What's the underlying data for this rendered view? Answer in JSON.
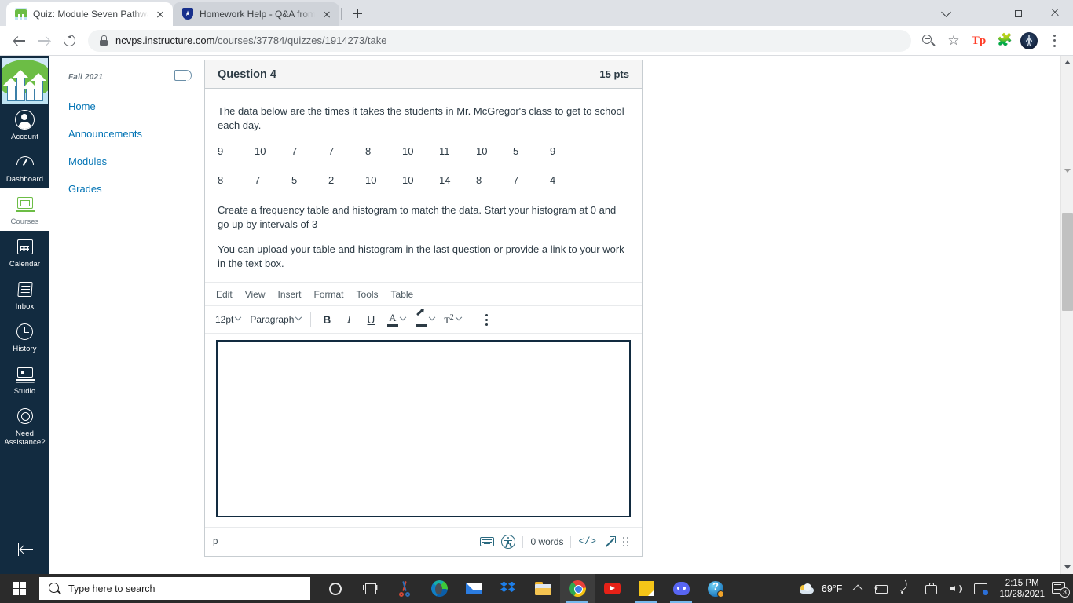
{
  "browser": {
    "tabs": [
      {
        "title": "Quiz: Module Seven Pathway Two",
        "favicon": "ncvps-logo-icon",
        "active": true
      },
      {
        "title": "Homework Help - Q&A from Onli",
        "favicon": "coursehero-shield-icon",
        "active": false
      }
    ],
    "new_tab_label": "+",
    "url_secure": "ncvps.instructure.com",
    "url_path": "/courses/37784/quizzes/1914273/take",
    "toolbar_icons": [
      "zoom-out-icon",
      "bookmark-star-icon",
      "tpt-extension-icon",
      "extensions-puzzle-icon",
      "profile-avatar-icon",
      "chrome-menu-icon"
    ],
    "window_controls": [
      "tab-search-chevron-icon",
      "minimize-icon",
      "maximize-icon",
      "close-icon"
    ]
  },
  "global_nav": {
    "logo_name": "ncvps-logo",
    "items": [
      {
        "label": "Account",
        "icon": "account-icon",
        "active": false
      },
      {
        "label": "Dashboard",
        "icon": "dashboard-icon",
        "active": false
      },
      {
        "label": "Courses",
        "icon": "courses-icon",
        "active": true
      },
      {
        "label": "Calendar",
        "icon": "calendar-icon",
        "active": false
      },
      {
        "label": "Inbox",
        "icon": "inbox-icon",
        "active": false
      },
      {
        "label": "History",
        "icon": "history-icon",
        "active": false
      },
      {
        "label": "Studio",
        "icon": "studio-icon",
        "active": false
      },
      {
        "label": "Need Assistance?",
        "icon": "help-icon",
        "active": false
      }
    ],
    "collapse_label": "minimize-nav-icon"
  },
  "course_nav": {
    "term": "Fall 2021",
    "links": [
      "Home",
      "Announcements",
      "Modules",
      "Grades"
    ],
    "pin_icon": "collapse-course-nav-icon"
  },
  "question": {
    "title": "Question 4",
    "points": "15 pts",
    "prompt": "The data below are the times it takes the students in Mr. McGregor's class to get to school each day.",
    "data_rows": [
      [
        "9",
        "10",
        "7",
        "7",
        "8",
        "10",
        "11",
        "10",
        "5",
        "9"
      ],
      [
        "8",
        "7",
        "5",
        "2",
        "10",
        "10",
        "14",
        "8",
        "7",
        "4"
      ]
    ],
    "instruction_1": "Create a frequency table and histogram to match the data. Start your histogram at 0 and go up by intervals of 3",
    "instruction_2": "You can upload your table and histogram in the last question or provide a link to your work in the text box."
  },
  "editor": {
    "menus": [
      "Edit",
      "View",
      "Insert",
      "Format",
      "Tools",
      "Table"
    ],
    "font_size": "12pt",
    "block_format": "Paragraph",
    "buttons": [
      {
        "label": "B",
        "name": "bold-button"
      },
      {
        "label": "I",
        "name": "italic-button"
      },
      {
        "label": "U",
        "name": "underline-button"
      }
    ],
    "text_color_label": "A",
    "superscript_label": "T",
    "superscript_exp": "2",
    "more_label": "more-options-icon",
    "body_value": "",
    "status": {
      "element_path": "p",
      "word_count": "0 words",
      "code_label": "</>",
      "icons": [
        "keyboard-shortcuts-icon",
        "accessibility-checker-icon",
        "html-editor-icon",
        "fullscreen-icon",
        "resize-handle-icon"
      ]
    }
  },
  "taskbar": {
    "start_label": "start-button",
    "search_placeholder": "Type here to search",
    "apps": [
      {
        "name": "cortana-icon"
      },
      {
        "name": "task-view-icon"
      },
      {
        "name": "snipping-tool-icon"
      },
      {
        "name": "microsoft-edge-icon"
      },
      {
        "name": "mail-icon"
      },
      {
        "name": "dropbox-icon"
      },
      {
        "name": "file-explorer-icon"
      },
      {
        "name": "google-chrome-icon"
      },
      {
        "name": "youtube-icon"
      },
      {
        "name": "sticky-notes-icon"
      },
      {
        "name": "discord-icon"
      },
      {
        "name": "help-icon"
      }
    ],
    "weather_temp": "69°F",
    "tray_icons": [
      "show-hidden-icons-chevron",
      "battery-icon",
      "wifi-icon",
      "camera-icon",
      "volume-icon",
      "display-icon"
    ],
    "time": "2:15 PM",
    "date": "10/28/2021",
    "notification_count": "3"
  },
  "colors": {
    "canvas_nav_bg": "#122b40",
    "link_blue": "#0374b5",
    "text_dark": "#2d3b45",
    "chrome_tab_bg": "#dee1e6"
  }
}
